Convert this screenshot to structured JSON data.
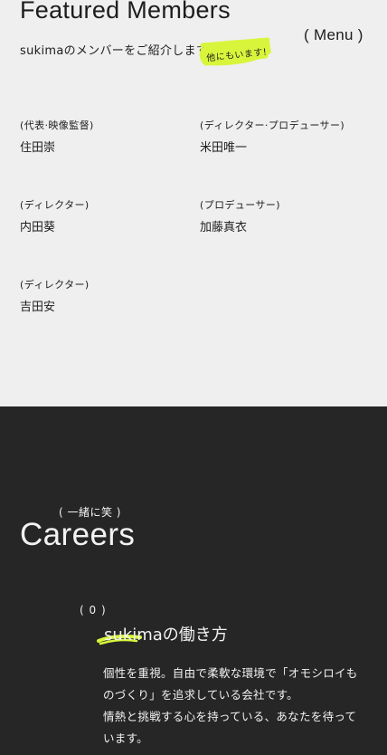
{
  "featured": {
    "title": "Featured Members",
    "subtitle": "sukimaのメンバーをご紹介します",
    "sticker": "他にもいます!",
    "members": [
      {
        "role": "(代表·映像監督)",
        "name": "住田崇"
      },
      {
        "role": "(ディレクター·プロデューサー)",
        "name": "米田唯一"
      },
      {
        "role": "(ディレクター)",
        "name": "内田葵"
      },
      {
        "role": "(プロデューサー)",
        "name": "加藤真衣"
      },
      {
        "role": "(ディレクター)",
        "name": "吉田安"
      }
    ]
  },
  "menu": {
    "label": "( Menu )"
  },
  "careers": {
    "note": "( 一緒に笑 )",
    "title": "Careers",
    "item": {
      "number": "( 0 )",
      "title": "sukimaの働き方",
      "body": [
        "個性を重視。自由で柔軟な環境で「オモシロイも",
        "のづくり」を追求している会社です。",
        "情熱と挑戦する心を持っている、あなたを待って",
        "います。"
      ]
    }
  },
  "colors": {
    "accent": "#d9f53b",
    "dark_bg": "#262626",
    "light_bg": "#efefef"
  }
}
